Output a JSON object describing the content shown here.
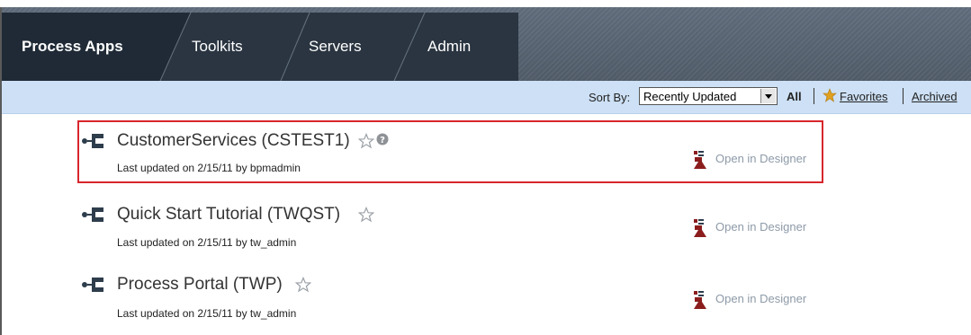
{
  "tabs": [
    {
      "label": "Process Apps",
      "active": true
    },
    {
      "label": "Toolkits",
      "active": false
    },
    {
      "label": "Servers",
      "active": false
    },
    {
      "label": "Admin",
      "active": false
    }
  ],
  "toolbar": {
    "sort_label": "Sort By:",
    "sort_value": "Recently Updated",
    "filters": {
      "all": "All",
      "favorites": "Favorites",
      "archived": "Archived"
    }
  },
  "apps": [
    {
      "title": "CustomerServices (CSTEST1)",
      "updated": "Last updated on 2/15/11 by bpmadmin",
      "action": "Open in Designer",
      "highlighted": true,
      "has_help": true
    },
    {
      "title": "Quick Start Tutorial (TWQST)",
      "updated": "Last updated on 2/15/11 by tw_admin",
      "action": "Open in Designer",
      "highlighted": false,
      "has_help": false
    },
    {
      "title": "Process Portal (TWP)",
      "updated": "Last updated on 2/15/11 by tw_admin",
      "action": "Open in Designer",
      "highlighted": false,
      "has_help": false
    }
  ],
  "colors": {
    "tabbar": "#55606d",
    "tab_active": "#1f2a36",
    "tab_inactive": "#2a3541",
    "toolbar": "#cde0f5",
    "highlight": "#d8262c",
    "link_muted": "#8d9aa8"
  },
  "icons": {
    "process_app": "process-app-icon",
    "favorite": "star-outline-icon",
    "help": "help-icon",
    "designer": "designer-icon",
    "favorites_filter": "star-filled-icon"
  }
}
